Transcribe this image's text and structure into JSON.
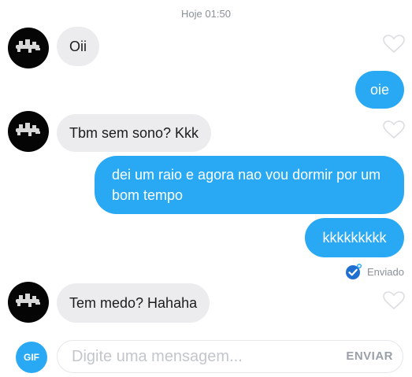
{
  "header": {
    "timestamp": "Hoje 01:50"
  },
  "messages": [
    {
      "direction": "in",
      "text": "Oii"
    },
    {
      "direction": "out",
      "text": "oie"
    },
    {
      "direction": "in",
      "text": "Tbm sem sono? Kkk"
    },
    {
      "direction": "out",
      "text": "dei um raio e agora nao vou dormir por um bom tempo"
    },
    {
      "direction": "out",
      "text": "kkkkkkkkk"
    },
    {
      "direction": "in",
      "text": "Tem medo? Hahaha"
    }
  ],
  "status": {
    "sent_label": "Enviado",
    "icon": "check-badge-icon"
  },
  "composer": {
    "gif_label": "GIF",
    "placeholder": "Digite uma mensagem...",
    "send_label": "ENVIAR"
  },
  "colors": {
    "accent": "#29a9f4",
    "incoming_bubble": "#ececef",
    "heart_outline": "#dcdde1",
    "muted_text": "#8a8f98"
  }
}
